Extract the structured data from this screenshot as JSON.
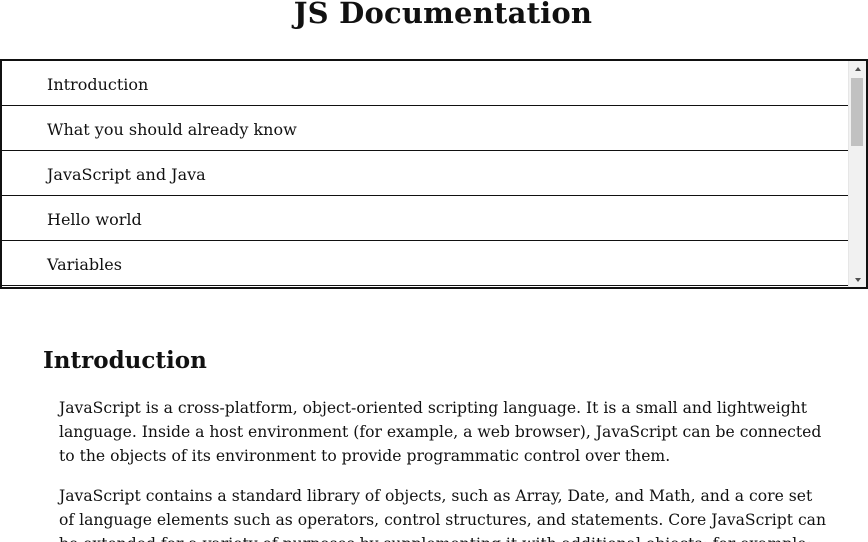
{
  "header": {
    "title": "JS Documentation"
  },
  "nav": {
    "items": [
      {
        "label": "Introduction"
      },
      {
        "label": "What you should already know"
      },
      {
        "label": "JavaScript and Java"
      },
      {
        "label": "Hello world"
      },
      {
        "label": "Variables"
      }
    ]
  },
  "main": {
    "section_heading": "Introduction",
    "paragraphs": [
      "JavaScript is a cross-platform, object-oriented scripting language. It is a small and lightweight language. Inside a host environment (for example, a web browser), JavaScript can be connected to the objects of its environment to provide programmatic control over them.",
      "JavaScript contains a standard library of objects, such as Array, Date, and Math, and a core set of language elements such as operators, control structures, and statements. Core JavaScript can be extended for a variety of purposes by supplementing it with additional objects; for example:"
    ]
  },
  "scrollbar": {
    "up_icon": "triangle-up-icon",
    "down_icon": "triangle-down-icon"
  }
}
